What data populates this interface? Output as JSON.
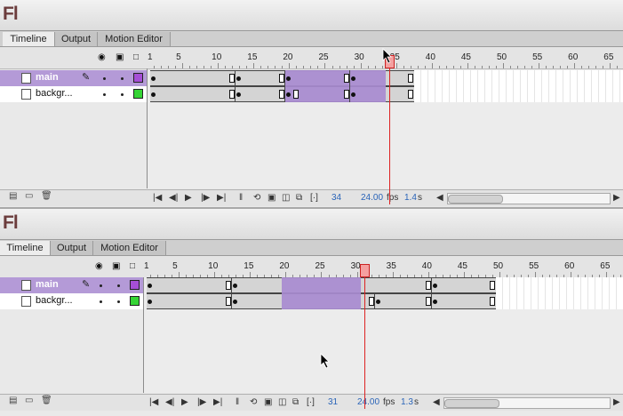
{
  "app": {
    "logo": "Fl"
  },
  "tabs": [
    {
      "label": "Timeline",
      "active": true
    },
    {
      "label": "Output",
      "active": false
    },
    {
      "label": "Motion Editor",
      "active": false
    }
  ],
  "header_icons": {
    "eye": "eye-icon",
    "lock": "lock-icon",
    "outline": "outline-icon"
  },
  "ruler": {
    "labels": [
      "1",
      "5",
      "10",
      "15",
      "20",
      "25",
      "30",
      "35",
      "40",
      "45",
      "50",
      "55",
      "60",
      "65"
    ]
  },
  "layers": [
    {
      "name": "main",
      "selected": true,
      "color": "#a64fd6"
    },
    {
      "name": "backgr...",
      "selected": false,
      "color": "#35d435"
    }
  ],
  "colors": {
    "selection": "#a88bd0",
    "layer_selected": "#b49ad7",
    "playhead": "#d22222",
    "frame_gray": "#d4d4d4"
  },
  "panels": [
    {
      "current_frame": "34",
      "fps": "24.00",
      "fps_label": "fps",
      "seconds": "1.4",
      "seconds_unit": "s",
      "selection": {
        "from": 20,
        "to": 34
      },
      "layer_frames": [
        {
          "span_end": 37,
          "keyframes": [
            1,
            13,
            20,
            29
          ],
          "ends": [
            12,
            19,
            28,
            37
          ]
        },
        {
          "span_end": 37,
          "keyframes": [
            1,
            13,
            20,
            29
          ],
          "ends": [
            12,
            19,
            21,
            28,
            37
          ]
        }
      ]
    },
    {
      "current_frame": "31",
      "fps": "24.00",
      "fps_label": "fps",
      "seconds": "1.3",
      "seconds_unit": "s",
      "selection": {
        "from": 20,
        "to": 31
      },
      "layer_frames": [
        {
          "span_end": 49,
          "keyframes": [
            1,
            13,
            41
          ],
          "ends": [
            12,
            40,
            49
          ]
        },
        {
          "span_end": 49,
          "keyframes": [
            1,
            13,
            33,
            41
          ],
          "ends": [
            12,
            32,
            40,
            49
          ]
        }
      ]
    }
  ]
}
